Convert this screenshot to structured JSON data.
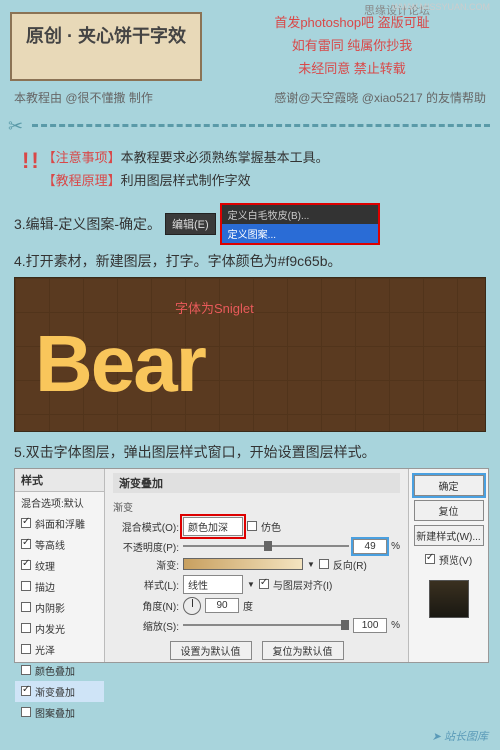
{
  "watermark": {
    "forum": "思缘设计论坛",
    "url": "WWW.MISSYUAN.COM",
    "footer": "站长图库"
  },
  "header": {
    "title": "原创 · 夹心饼干字效",
    "red1": "首发photoshop吧  盗版可耻",
    "red2": "如有雷同 纯属你抄我",
    "red3": "未经同意 禁止转载"
  },
  "credits": {
    "left": "本教程由 @很不懂撒 制作",
    "right": "感谢@天空霞晓 @xiao5217 的友情帮助"
  },
  "notice": {
    "line1_label": "【注意事项】",
    "line1_text": "本教程要求必须熟练掌握基本工具。",
    "line2_label": "【教程原理】",
    "line2_text": "利用图层样式制作字效"
  },
  "steps": {
    "s3": "3.编辑-定义图案-确定。",
    "edit_btn": "编辑(E)",
    "dd_top": "定义白毛牧皮(B)...",
    "dd_sel": "定义图案...",
    "s4": "4.打开素材，新建图层，打字。字体颜色为#f9c65b。",
    "font_note": "字体为Sniglet",
    "bear": "Bear",
    "s5": "5.双击字体图层，弹出图层样式窗口，开始设置图层样式。"
  },
  "dialog": {
    "left_hdr": "样式",
    "blend_default": "混合选项:默认",
    "opts": [
      "斜面和浮雕",
      "等高线",
      "纹理",
      "描边",
      "内阴影",
      "内发光",
      "光泽",
      "颜色叠加",
      "渐变叠加",
      "图案叠加"
    ],
    "checked": [
      true,
      true,
      true,
      false,
      false,
      false,
      false,
      false,
      true,
      false
    ],
    "sel_idx": 8,
    "mid_hdr": "渐变叠加",
    "section": "渐变",
    "blend_mode_lbl": "混合模式(O):",
    "blend_mode_val": "颜色加深",
    "dither": "仿色",
    "opacity_lbl": "不透明度(P):",
    "opacity_val": "49",
    "pct": "%",
    "grad_lbl": "渐变:",
    "reverse": "反向(R)",
    "style_lbl": "样式(L):",
    "style_val": "线性",
    "align": "与图层对齐(I)",
    "angle_lbl": "角度(N):",
    "angle_val": "90",
    "deg": "度",
    "scale_lbl": "缩放(S):",
    "scale_val": "100",
    "def1": "设置为默认值",
    "def2": "复位为默认值",
    "ok": "确定",
    "cancel": "复位",
    "newstyle": "新建样式(W)...",
    "preview": "预览(V)"
  }
}
